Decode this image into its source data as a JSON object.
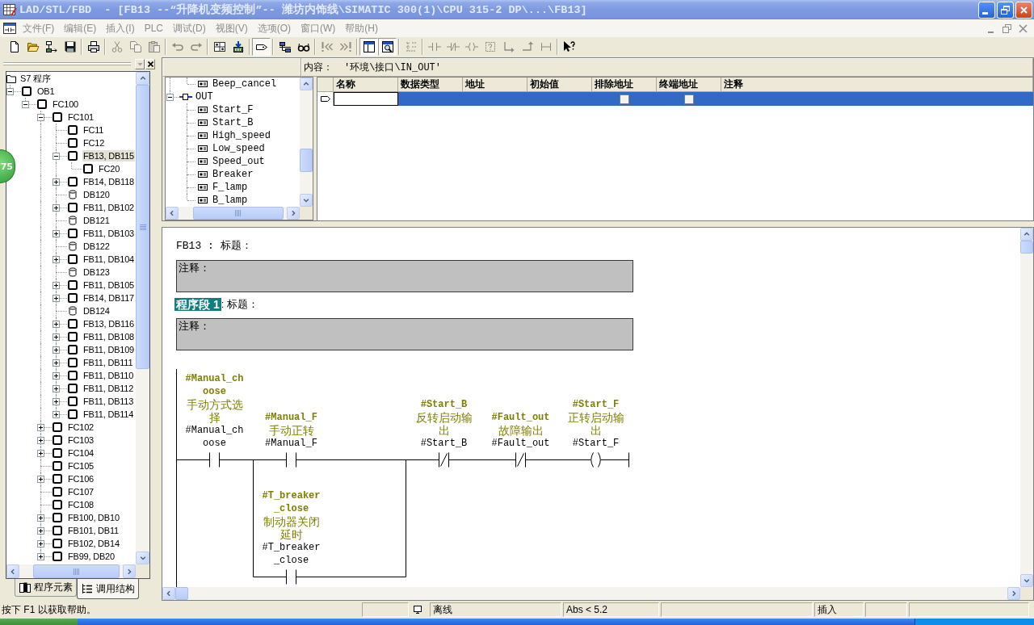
{
  "window": {
    "title": "LAD/STL/FBD  - [FB13 --“升降机变频控制”-- 潍坊内饰线\\SIMATIC 300(1)\\CPU 315-2 DP\\...\\FB13]",
    "active": false
  },
  "menu": [
    {
      "label": "文件(F)",
      "disabled": true
    },
    {
      "label": "编辑(E)",
      "disabled": true
    },
    {
      "label": "插入(I)",
      "disabled": true
    },
    {
      "label": "PLC",
      "disabled": true
    },
    {
      "label": "调试(D)",
      "disabled": true
    },
    {
      "label": "视图(V)",
      "disabled": true
    },
    {
      "label": "选项(O)",
      "disabled": true
    },
    {
      "label": "窗口(W)",
      "disabled": true
    },
    {
      "label": "帮助(H)",
      "disabled": true
    }
  ],
  "toolbar": [
    {
      "disabled": false,
      "pressed": false
    },
    {
      "disabled": false,
      "pressed": false
    },
    {
      "disabled": false,
      "pressed": false
    },
    {
      "disabled": false,
      "pressed": false
    },
    {
      "disabled": false,
      "pressed": false
    },
    {
      "disabled": true,
      "pressed": false
    },
    {
      "disabled": true,
      "pressed": false
    },
    {
      "disabled": true,
      "pressed": false
    },
    {
      "disabled": true,
      "pressed": false
    },
    {
      "disabled": true,
      "pressed": false
    },
    {
      "disabled": false,
      "pressed": false
    },
    {
      "disabled": false,
      "pressed": false
    },
    {
      "disabled": false,
      "pressed": true
    },
    {
      "disabled": false,
      "pressed": false
    },
    {
      "disabled": false,
      "pressed": false
    },
    {
      "disabled": true,
      "pressed": false
    },
    {
      "disabled": true,
      "pressed": false
    },
    {
      "disabled": false,
      "pressed": true
    },
    {
      "disabled": false,
      "pressed": true
    },
    {
      "disabled": true,
      "pressed": false
    },
    {
      "disabled": true,
      "pressed": false
    },
    {
      "disabled": true,
      "pressed": false
    },
    {
      "disabled": true,
      "pressed": false
    },
    {
      "disabled": true,
      "pressed": false
    },
    {
      "disabled": true,
      "pressed": false
    },
    {
      "disabled": true,
      "pressed": false
    },
    {
      "disabled": true,
      "pressed": false
    },
    {
      "disabled": false,
      "pressed": false
    }
  ],
  "floating_badge": {
    "text": "75"
  },
  "program_tree": {
    "items": [
      {
        "label": "S7 程序",
        "kind": "folder",
        "selected": false,
        "children": [
          {
            "label": "OB1",
            "kind": "block",
            "selected": false,
            "expanded": true,
            "children": [
              {
                "label": "FC100",
                "kind": "block",
                "selected": false,
                "expanded": true,
                "children": [
                  {
                    "label": "FC101",
                    "kind": "block",
                    "selected": false,
                    "expanded": true,
                    "children": [
                      {
                        "label": "FC11",
                        "kind": "block",
                        "selected": false
                      },
                      {
                        "label": "FC12",
                        "kind": "block",
                        "selected": false
                      },
                      {
                        "label": "FB13, DB115",
                        "kind": "block",
                        "selected": true,
                        "expanded": true,
                        "children": [
                          {
                            "label": "FC20",
                            "kind": "block",
                            "selected": false
                          }
                        ]
                      },
                      {
                        "label": "FB14, DB118",
                        "kind": "block",
                        "selected": false,
                        "expanded": false
                      },
                      {
                        "label": "DB120",
                        "kind": "db",
                        "selected": false
                      },
                      {
                        "label": "FB11, DB102",
                        "kind": "block",
                        "selected": false,
                        "expanded": false
                      },
                      {
                        "label": "DB121",
                        "kind": "db",
                        "selected": false
                      },
                      {
                        "label": "FB11, DB103",
                        "kind": "block",
                        "selected": false,
                        "expanded": false
                      },
                      {
                        "label": "DB122",
                        "kind": "db",
                        "selected": false
                      },
                      {
                        "label": "FB11, DB104",
                        "kind": "block",
                        "selected": false,
                        "expanded": false
                      },
                      {
                        "label": "DB123",
                        "kind": "db",
                        "selected": false
                      },
                      {
                        "label": "FB11, DB105",
                        "kind": "block",
                        "selected": false,
                        "expanded": false
                      },
                      {
                        "label": "FB14, DB117",
                        "kind": "block",
                        "selected": false,
                        "expanded": false
                      },
                      {
                        "label": "DB124",
                        "kind": "db",
                        "selected": false
                      },
                      {
                        "label": "FB13, DB116",
                        "kind": "block",
                        "selected": false,
                        "expanded": false
                      },
                      {
                        "label": "FB11, DB108",
                        "kind": "block",
                        "selected": false,
                        "expanded": false
                      },
                      {
                        "label": "FB11, DB109",
                        "kind": "block",
                        "selected": false,
                        "expanded": false
                      },
                      {
                        "label": "FB11, DB111",
                        "kind": "block",
                        "selected": false,
                        "expanded": false
                      },
                      {
                        "label": "FB11, DB110",
                        "kind": "block",
                        "selected": false,
                        "expanded": false
                      },
                      {
                        "label": "FB11, DB112",
                        "kind": "block",
                        "selected": false,
                        "expanded": false
                      },
                      {
                        "label": "FB11, DB113",
                        "kind": "block",
                        "selected": false,
                        "expanded": false
                      },
                      {
                        "label": "FB11, DB114",
                        "kind": "block",
                        "selected": false,
                        "expanded": false
                      }
                    ]
                  },
                  {
                    "label": "FC102",
                    "kind": "block",
                    "selected": false,
                    "expanded": false
                  },
                  {
                    "label": "FC103",
                    "kind": "block",
                    "selected": false,
                    "expanded": false
                  },
                  {
                    "label": "FC104",
                    "kind": "block",
                    "selected": false,
                    "expanded": false
                  },
                  {
                    "label": "FC105",
                    "kind": "block",
                    "selected": false
                  },
                  {
                    "label": "FC106",
                    "kind": "block",
                    "selected": false,
                    "expanded": false
                  },
                  {
                    "label": "FC107",
                    "kind": "block",
                    "selected": false
                  },
                  {
                    "label": "FC108",
                    "kind": "block",
                    "selected": false
                  },
                  {
                    "label": "FB100, DB10",
                    "kind": "block",
                    "selected": false,
                    "expanded": false
                  },
                  {
                    "label": "FB101, DB11",
                    "kind": "block",
                    "selected": false,
                    "expanded": false
                  },
                  {
                    "label": "FB102, DB14",
                    "kind": "block",
                    "selected": false,
                    "expanded": false
                  },
                  {
                    "label": "FB99, DB20",
                    "kind": "block",
                    "selected": false,
                    "expanded": false
                  }
                ]
              }
            ]
          }
        ]
      }
    ],
    "tabs": [
      {
        "label": "程序元素",
        "selected": false
      },
      {
        "label": "调用结构",
        "selected": true
      }
    ]
  },
  "interface": {
    "content_label": "内容：",
    "content_path": "'环境\\接口\\IN_OUT'",
    "tree": [
      {
        "children": [
          {
            "label": "Beep_cancel",
            "kind": "param",
            "selected": false
          }
        ]
      },
      {
        "label": "OUT",
        "kind": "section",
        "selected": false,
        "expanded": true,
        "children": [
          {
            "label": "Start_F",
            "kind": "param",
            "selected": false
          },
          {
            "label": "Start_B",
            "kind": "param",
            "selected": false
          },
          {
            "label": "High_speed",
            "kind": "param",
            "selected": false
          },
          {
            "label": "Low_speed",
            "kind": "param",
            "selected": false
          },
          {
            "label": "Speed_out",
            "kind": "param",
            "selected": false
          },
          {
            "label": "Breaker",
            "kind": "param",
            "selected": false
          },
          {
            "label": "F_lamp",
            "kind": "param",
            "selected": false
          },
          {
            "label": "B_lamp",
            "kind": "param",
            "selected": false
          }
        ]
      }
    ],
    "table": {
      "columns": [
        "名称",
        "数据类型",
        "地址",
        "初始值",
        "排除地址",
        "终端地址",
        "注释"
      ],
      "rows": [
        {
          "selected": true,
          "exclude_address": false,
          "terminal_address": false
        }
      ]
    }
  },
  "editor": {
    "block_title": "FB13 : 标题：",
    "block_comment": "注释：",
    "networks": [
      {
        "label": "程序段 1",
        "selected": true,
        "title": ": 标题：",
        "comment": "注释：",
        "ladder": {
          "main": [
            {
              "kind": "no_contact",
              "symbol": "#Manual_choose",
              "comment": "手动方式选择",
              "operand": "#Manual_choose"
            },
            {
              "kind": "no_contact",
              "symbol": "#Manual_F",
              "comment": "手动正转",
              "operand": "#Manual_F"
            },
            {
              "kind": "nc_contact",
              "symbol": "#Start_B",
              "comment": "反转启动输出",
              "operand": "#Start_B"
            },
            {
              "kind": "nc_contact",
              "symbol": "#Fault_out",
              "comment": "故障输出",
              "operand": "#Fault_out"
            },
            {
              "kind": "coil",
              "symbol": "#Start_F",
              "comment": "正转启动输出",
              "operand": "#Start_F"
            }
          ],
          "parallel_branch": [
            {
              "kind": "no_contact",
              "symbol": "#T_breaker_close",
              "comment": "制动器关闭延时",
              "operand": "#T_breaker_close"
            }
          ]
        }
      }
    ]
  },
  "status_bar": {
    "help_text": "按下 F1 以获取帮助。",
    "connection": "离线",
    "version": "Abs < 5.2",
    "insert_mode": "插入"
  }
}
